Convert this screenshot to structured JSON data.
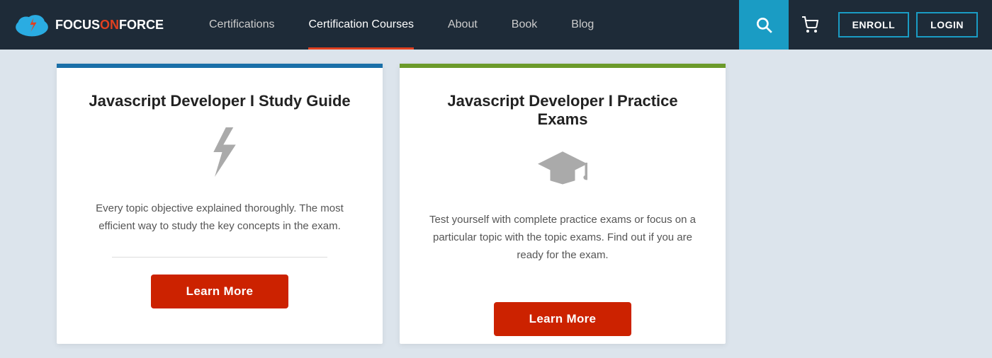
{
  "nav": {
    "logo_text_focus": "FOCUS",
    "logo_text_on": "ON",
    "logo_text_force": "FORCE",
    "links": [
      {
        "label": "Certifications",
        "active": false
      },
      {
        "label": "Certification Courses",
        "active": true
      },
      {
        "label": "About",
        "active": false
      },
      {
        "label": "Book",
        "active": false
      },
      {
        "label": "Blog",
        "active": false
      }
    ],
    "enroll_label": "ENROLL",
    "login_label": "LOGIN"
  },
  "cards": [
    {
      "top_bar_class": "blue",
      "title": "Javascript Developer I  Study Guide",
      "icon_type": "bolt",
      "description": "Every topic objective explained thoroughly. The most efficient way to study the key concepts in the exam.",
      "learn_more_label": "Learn More"
    },
    {
      "top_bar_class": "green",
      "title": "Javascript Developer I  Practice Exams",
      "icon_type": "graduation",
      "description": "Test yourself with complete practice exams or focus on a particular topic with the topic exams. Find out if you are ready for the exam.",
      "learn_more_label": "Learn More"
    }
  ]
}
